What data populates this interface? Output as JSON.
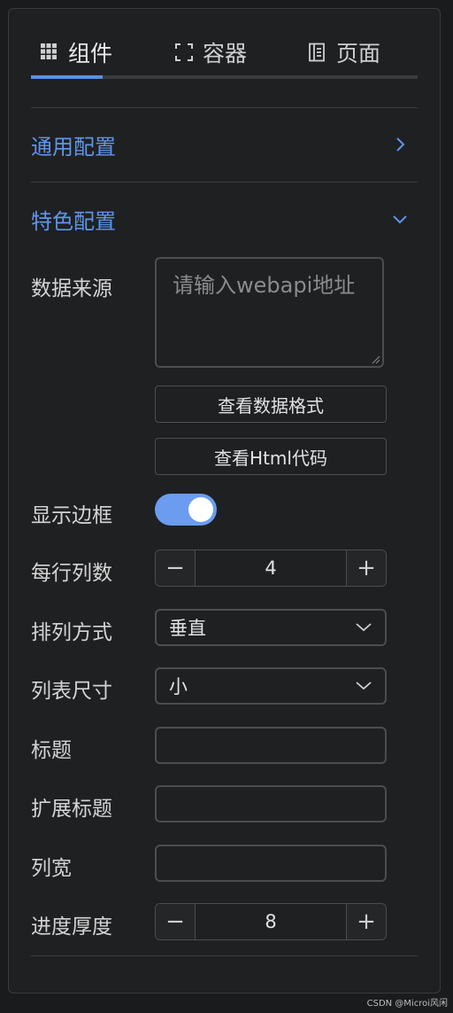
{
  "tabs": [
    {
      "label": "组件",
      "icon": "grid-icon",
      "active": true
    },
    {
      "label": "容器",
      "icon": "frame-icon",
      "active": false
    },
    {
      "label": "页面",
      "icon": "page-icon",
      "active": false
    }
  ],
  "sections": {
    "general": {
      "title": "通用配置",
      "expanded": false
    },
    "feature": {
      "title": "特色配置",
      "expanded": true
    }
  },
  "form": {
    "data_source": {
      "label": "数据来源",
      "placeholder": "请输入webapi地址",
      "value": ""
    },
    "view_format_button": "查看数据格式",
    "view_html_button": "查看Html代码",
    "show_border": {
      "label": "显示边框",
      "on": true
    },
    "columns_per_row": {
      "label": "每行列数",
      "value": "4",
      "minus": "−",
      "plus": "+"
    },
    "arrangement": {
      "label": "排列方式",
      "value": "垂直"
    },
    "list_size": {
      "label": "列表尺寸",
      "value": "小"
    },
    "title": {
      "label": "标题",
      "value": ""
    },
    "ext_title": {
      "label": "扩展标题",
      "value": ""
    },
    "col_width": {
      "label": "列宽",
      "value": ""
    },
    "progress_thickness": {
      "label": "进度厚度",
      "value": "8",
      "minus": "−",
      "plus": "+"
    }
  },
  "colors": {
    "accent": "#5f95ea",
    "switch_on": "#6b9cf0",
    "panel": "#1f2022",
    "border": "#4b4d50"
  },
  "watermark": "CSDN @Microi风闲"
}
